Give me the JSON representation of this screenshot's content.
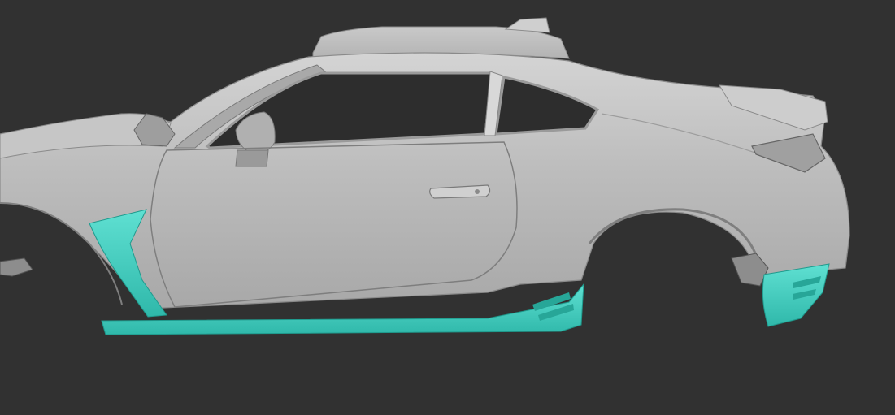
{
  "scene": {
    "background_color": "#313131",
    "body_color": "#bdbdbd",
    "part_highlight_color": "#3fd1c2",
    "glass_color": "#2d2d2d"
  }
}
